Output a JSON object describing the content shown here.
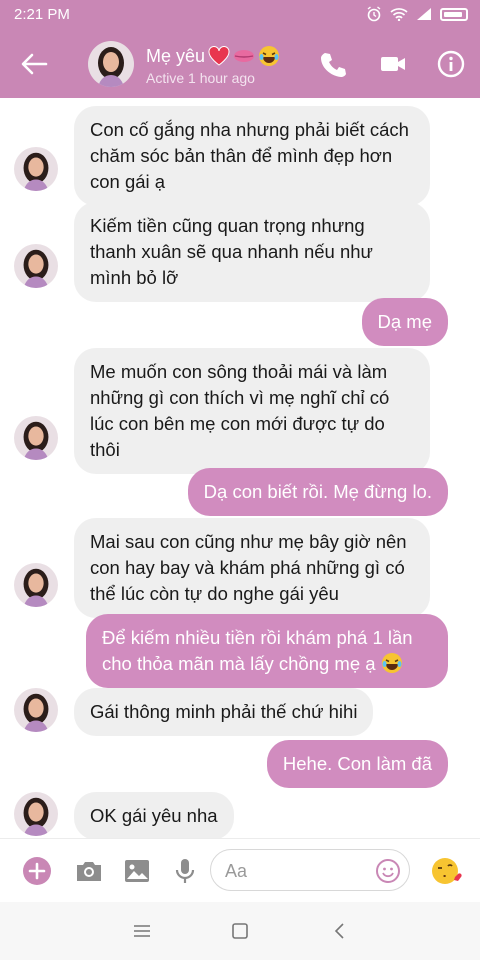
{
  "status_bar": {
    "time": "2:21 PM"
  },
  "header": {
    "contact_name": "Mẹ yêu",
    "status": "Active 1 hour ago"
  },
  "messages": [
    {
      "side": "in",
      "text": "Con cố gắng nha nhưng phải biết cách chăm sóc bản thân để mình đẹp hơn con gái ạ"
    },
    {
      "side": "in",
      "text": "Kiếm tiền cũng quan trọng nhưng thanh xuân sẽ qua nhanh nếu như mình bỏ lỡ"
    },
    {
      "side": "out",
      "text": "Dạ mẹ"
    },
    {
      "side": "in",
      "text": "Me muốn con sông thoải mái và làm những gì con thích vì mẹ nghĩ chỉ có lúc con bên mẹ con mới được tự do thôi"
    },
    {
      "side": "out",
      "text": "Dạ con biết rồi. Mẹ đừng lo."
    },
    {
      "side": "in",
      "text": "Mai sau con cũng như mẹ bây giờ nên con hay bay và khám phá những gì có thể lúc còn tự do nghe gái yêu"
    },
    {
      "side": "out",
      "text": "Để kiếm nhiều tiền rồi khám phá 1 lần cho thỏa mãn mà lấy chồng mẹ ạ"
    },
    {
      "side": "in",
      "text": "Gái thông minh phải thế chứ hihi"
    },
    {
      "side": "out",
      "text": "Hehe. Con làm đã"
    },
    {
      "side": "in",
      "text": "OK gái yêu nha"
    }
  ],
  "composer": {
    "placeholder": "Aa"
  },
  "colors": {
    "accent": "#c987b5",
    "outgoing_bubble": "#d18cbf",
    "incoming_bubble": "#efefef"
  },
  "icons": [
    "back-arrow-icon",
    "phone-icon",
    "video-camera-icon",
    "info-icon",
    "plus-icon",
    "camera-icon",
    "image-icon",
    "microphone-icon",
    "emoji-icon",
    "winking-kiss-emoji-icon"
  ]
}
